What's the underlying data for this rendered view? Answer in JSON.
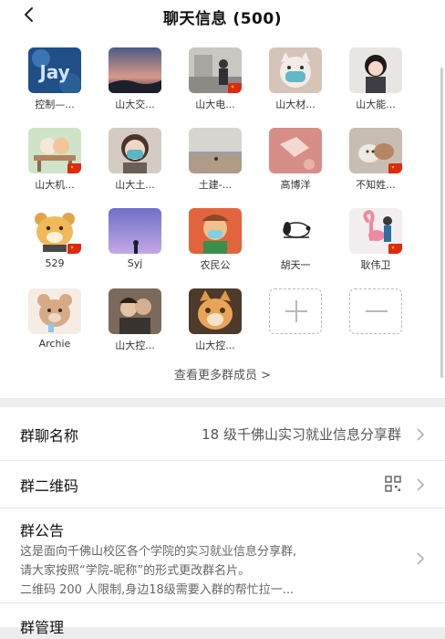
{
  "header": {
    "title": "聊天信息 (500)"
  },
  "members": [
    {
      "name": "控制—...",
      "avatar": "jay-avatar",
      "flag": false
    },
    {
      "name": "山大交...",
      "avatar": "sunset-avatar",
      "flag": false
    },
    {
      "name": "山大电...",
      "avatar": "street-avatar",
      "flag": true
    },
    {
      "name": "山大材...",
      "avatar": "cat-mask-avatar",
      "flag": false
    },
    {
      "name": "山大能...",
      "avatar": "girl-avatar",
      "flag": false
    },
    {
      "name": "山大机...",
      "avatar": "cartoon-desk-avatar",
      "flag": true
    },
    {
      "name": "山大土...",
      "avatar": "mask-girl-avatar",
      "flag": false
    },
    {
      "name": "土建-...",
      "avatar": "beach-avatar",
      "flag": false
    },
    {
      "name": "高博洋",
      "avatar": "pink-pattern-avatar",
      "flag": false
    },
    {
      "name": "不知姓...",
      "avatar": "cat-photo-avatar",
      "flag": true
    },
    {
      "name": "529",
      "avatar": "bear-avatar",
      "flag": true
    },
    {
      "name": "Syj",
      "avatar": "night-sky-avatar",
      "flag": false
    },
    {
      "name": "农民公",
      "avatar": "cartoon-mask-avatar",
      "flag": false
    },
    {
      "name": "胡天一",
      "avatar": "snoopy-avatar",
      "flag": false
    },
    {
      "name": "耿伟卫",
      "avatar": "flamingo-avatar",
      "flag": true
    },
    {
      "name": "Archie",
      "avatar": "teddy-avatar",
      "flag": false
    },
    {
      "name": "山大控...",
      "avatar": "couple-avatar",
      "flag": false
    },
    {
      "name": "山大控...",
      "avatar": "orange-cat-avatar",
      "flag": false
    }
  ],
  "more_members": "查看更多群成员 >",
  "group_name": {
    "label": "群聊名称",
    "value": "18 级千佛山实习就业信息分享群"
  },
  "qr_code": {
    "label": "群二维码"
  },
  "notice": {
    "label": "群公告",
    "lines": [
      "这是面向千佛山校区各个学院的实习就业信息分享群,",
      "请大家按照“学院-昵称”的形式更改群名片。",
      "二维码 200 人限制,身边18级需要入群的帮忙拉一..."
    ]
  },
  "manage": {
    "label": "群管理"
  },
  "colors": {
    "flag": "#de2910",
    "star": "#ffde00"
  }
}
